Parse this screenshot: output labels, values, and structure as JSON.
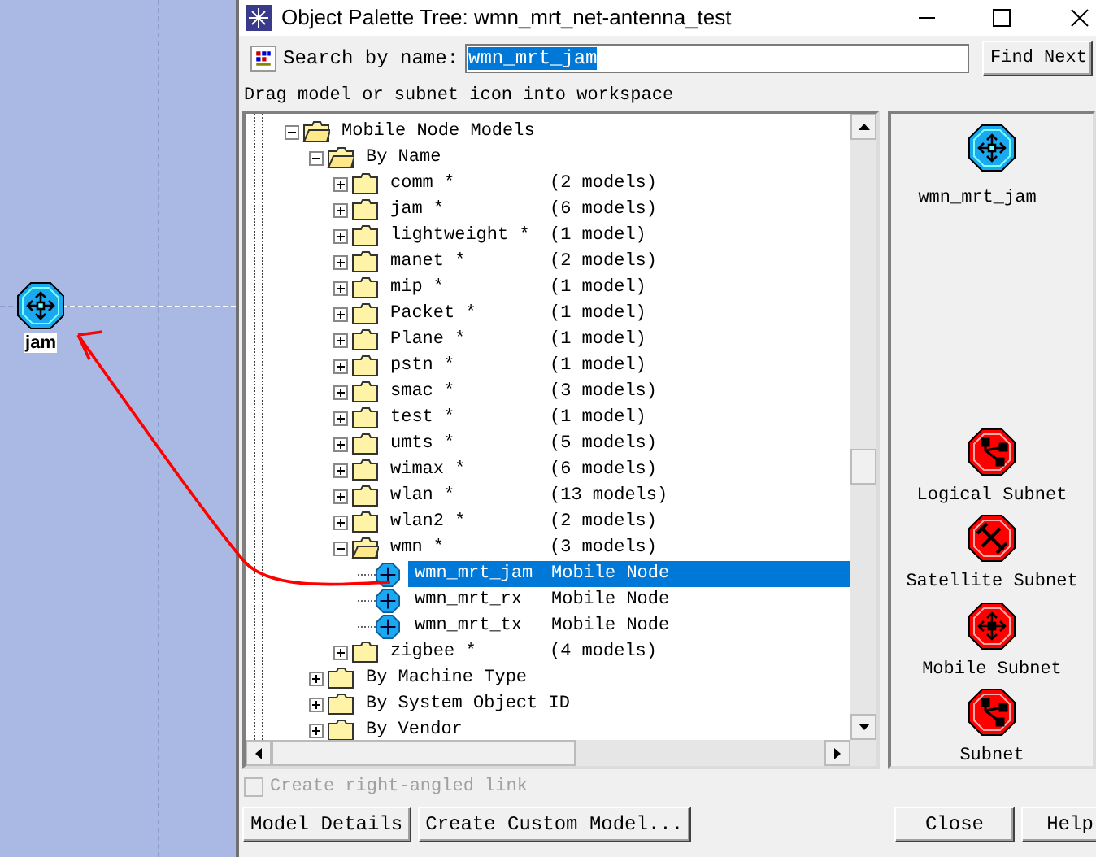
{
  "workspace": {
    "nodes": [
      {
        "label": "jam"
      }
    ]
  },
  "window": {
    "title": "Object Palette Tree: wmn_mrt_net-antenna_test"
  },
  "search": {
    "label": "Search by name:",
    "value": "wmn_mrt_jam",
    "button": "Find Next"
  },
  "hint": "Drag model or subnet icon into workspace",
  "tree": [
    {
      "label": "Mobile Node Models",
      "expanded": true,
      "children": [
        {
          "label": "By Name",
          "expanded": true,
          "children": [
            {
              "label": "comm *",
              "count": "(2 models)",
              "expanded": false
            },
            {
              "label": "jam *",
              "count": "(6 models)",
              "expanded": false
            },
            {
              "label": "lightweight *",
              "count": "(1 model)",
              "expanded": false
            },
            {
              "label": "manet *",
              "count": "(2 models)",
              "expanded": false
            },
            {
              "label": "mip *",
              "count": "(1 model)",
              "expanded": false
            },
            {
              "label": "Packet *",
              "count": "(1 model)",
              "expanded": false
            },
            {
              "label": "Plane *",
              "count": "(1 model)",
              "expanded": false
            },
            {
              "label": "pstn *",
              "count": "(1 model)",
              "expanded": false
            },
            {
              "label": "smac *",
              "count": "(3 models)",
              "expanded": false
            },
            {
              "label": "test *",
              "count": "(1 model)",
              "expanded": false
            },
            {
              "label": "umts *",
              "count": "(5 models)",
              "expanded": false
            },
            {
              "label": "wimax *",
              "count": "(6 models)",
              "expanded": false
            },
            {
              "label": "wlan *",
              "count": "(13 models)",
              "expanded": false
            },
            {
              "label": "wlan2 *",
              "count": "(2 models)",
              "expanded": false
            },
            {
              "label": "wmn *",
              "count": "(3 models)",
              "expanded": true,
              "children": [
                {
                  "kind": "model",
                  "label": "wmn_mrt_jam",
                  "type": "Mobile Node",
                  "selected": true
                },
                {
                  "kind": "model",
                  "label": "wmn_mrt_rx",
                  "type": "Mobile Node",
                  "selected": false
                },
                {
                  "kind": "model",
                  "label": "wmn_mrt_tx",
                  "type": "Mobile Node",
                  "selected": false
                }
              ]
            },
            {
              "label": "zigbee *",
              "count": "(4 models)",
              "expanded": false
            }
          ]
        },
        {
          "label": "By Machine Type",
          "expanded": false
        },
        {
          "label": "By System Object ID",
          "expanded": false
        },
        {
          "label": "By Vendor",
          "expanded": false
        }
      ]
    }
  ],
  "palette": [
    {
      "kind": "node",
      "label": "wmn_mrt_jam"
    },
    {
      "kind": "logical",
      "label": "Logical Subnet"
    },
    {
      "kind": "satellite",
      "label": "Satellite Subnet"
    },
    {
      "kind": "mobile",
      "label": "Mobile Subnet"
    },
    {
      "kind": "subnet",
      "label": "Subnet"
    }
  ],
  "option": {
    "label": "Create right-angled link",
    "checked": false,
    "disabled": true
  },
  "buttons": [
    "Model Details",
    "Create Custom Model...",
    "Close",
    "Help"
  ]
}
